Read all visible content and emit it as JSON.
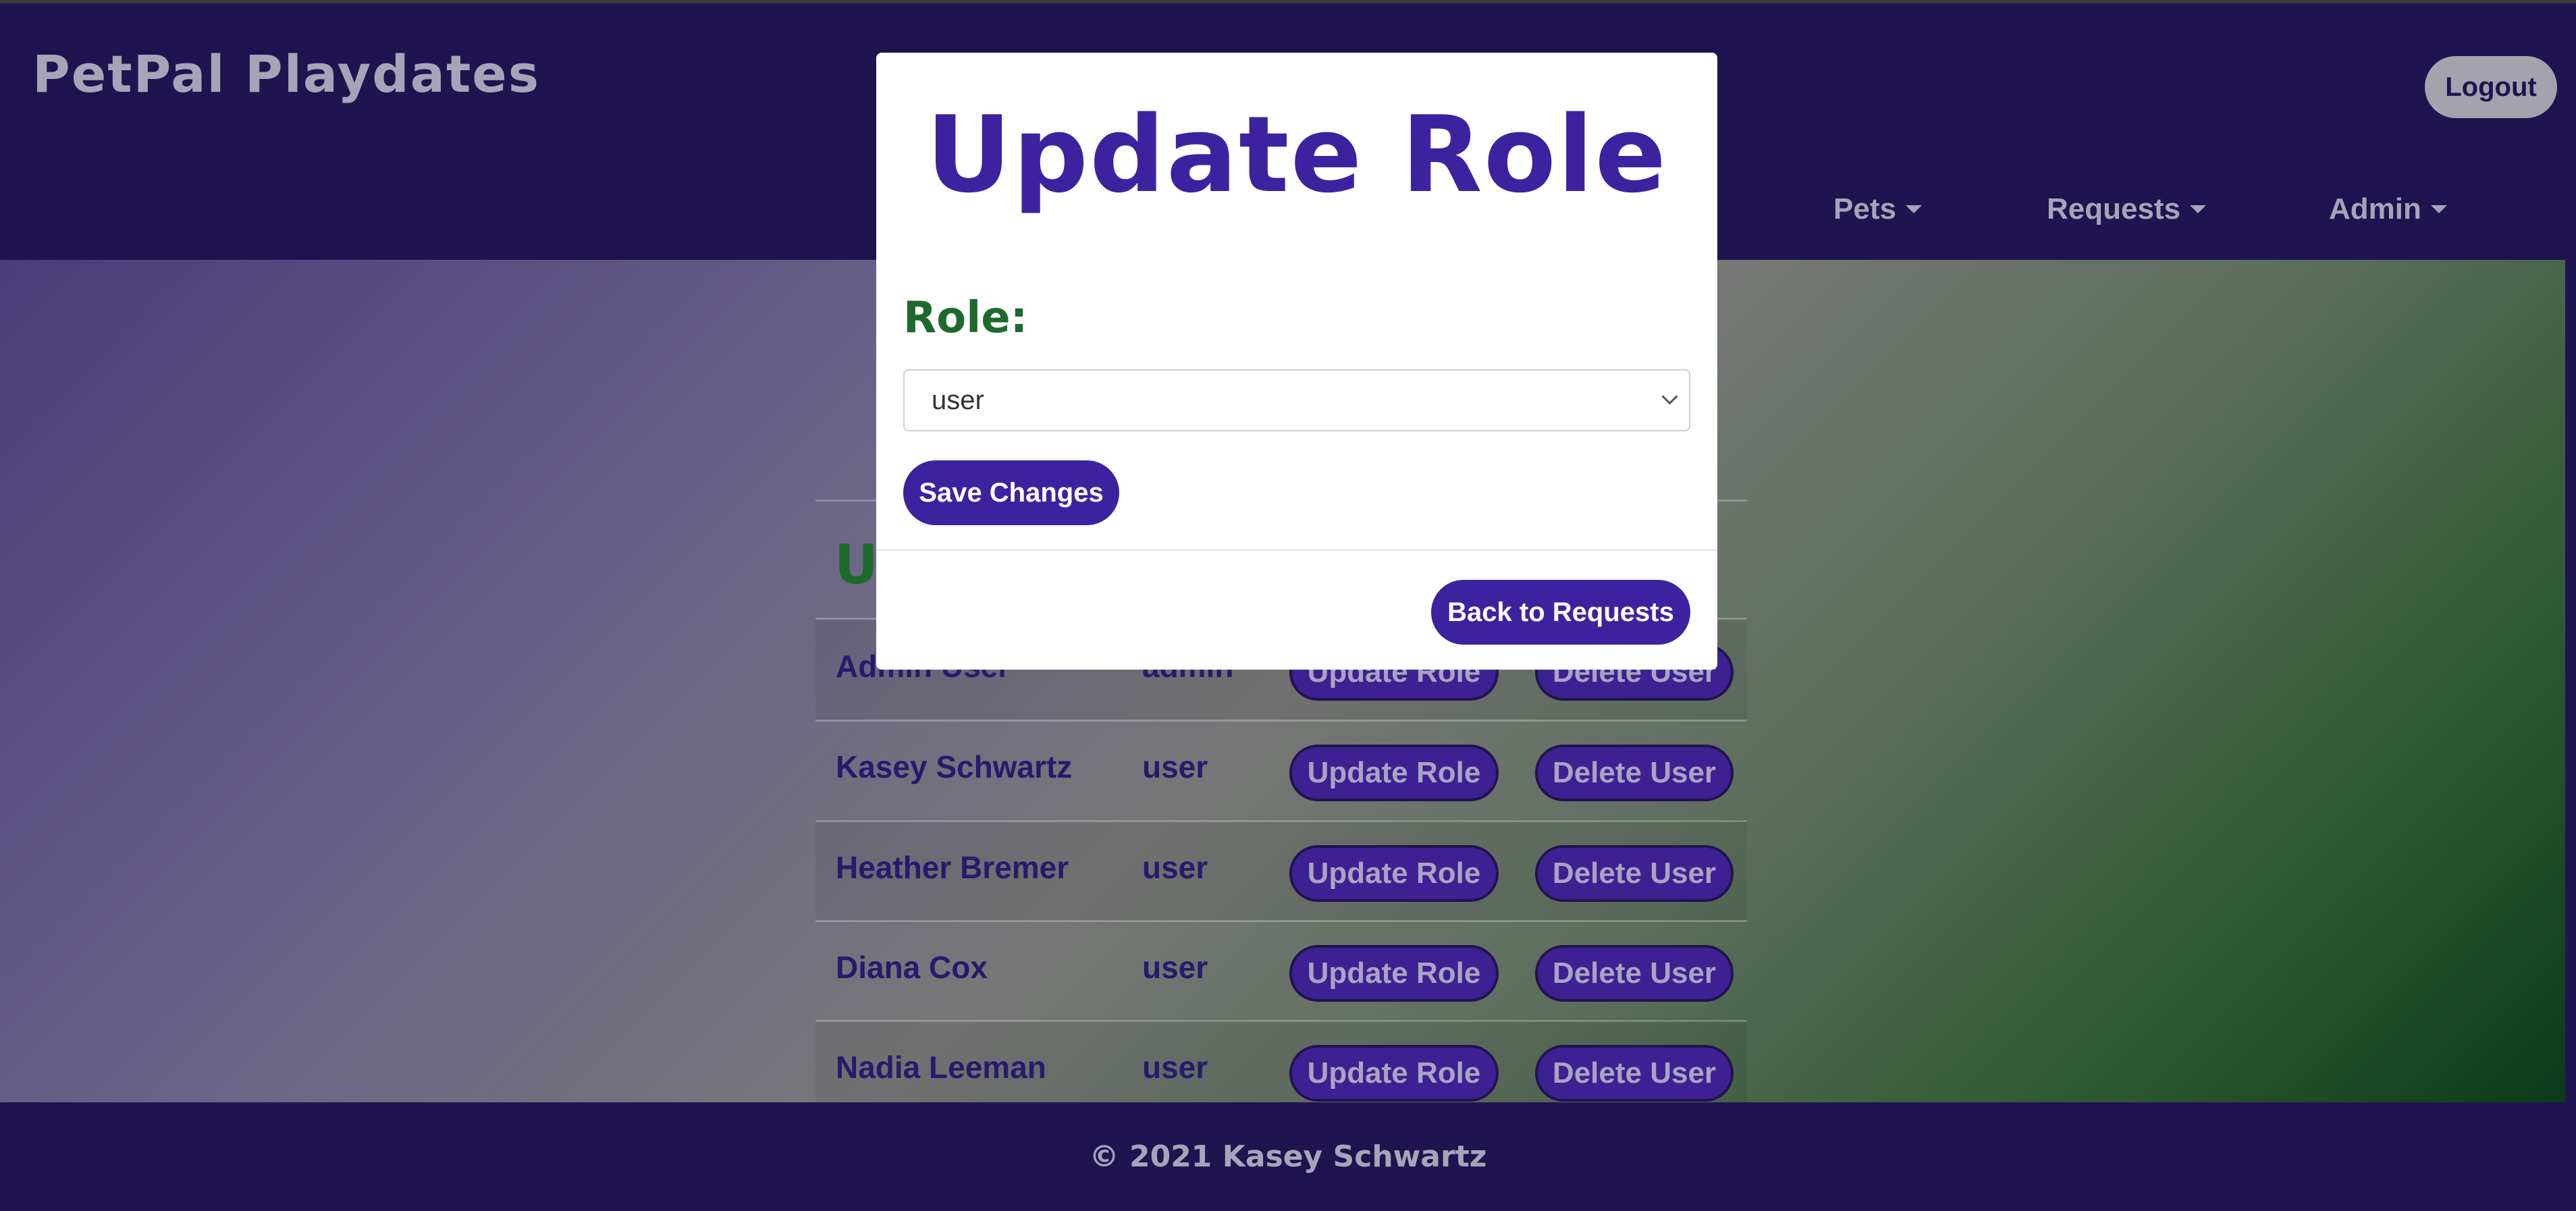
{
  "header": {
    "brand": "PetPal Playdates",
    "logout_label": "Logout",
    "nav": [
      {
        "label": "Pets"
      },
      {
        "label": "Requests"
      },
      {
        "label": "Admin"
      }
    ]
  },
  "users": {
    "heading_partial": "Us",
    "rows": [
      {
        "name": "Admin User",
        "role": "admin",
        "update_label": "Update Role",
        "delete_label": "Delete User"
      },
      {
        "name": "Kasey Schwartz",
        "role": "user",
        "update_label": "Update Role",
        "delete_label": "Delete User"
      },
      {
        "name": "Heather Bremer",
        "role": "user",
        "update_label": "Update Role",
        "delete_label": "Delete User"
      },
      {
        "name": "Diana Cox",
        "role": "user",
        "update_label": "Update Role",
        "delete_label": "Delete User"
      },
      {
        "name": "Nadia Leeman",
        "role": "user",
        "update_label": "Update Role",
        "delete_label": "Delete User"
      }
    ]
  },
  "modal": {
    "title": "Update Role",
    "role_label": "Role:",
    "role_value": "user",
    "save_label": "Save Changes",
    "back_label": "Back to Requests"
  },
  "footer": {
    "text": "© 2021 Kasey Schwartz"
  }
}
